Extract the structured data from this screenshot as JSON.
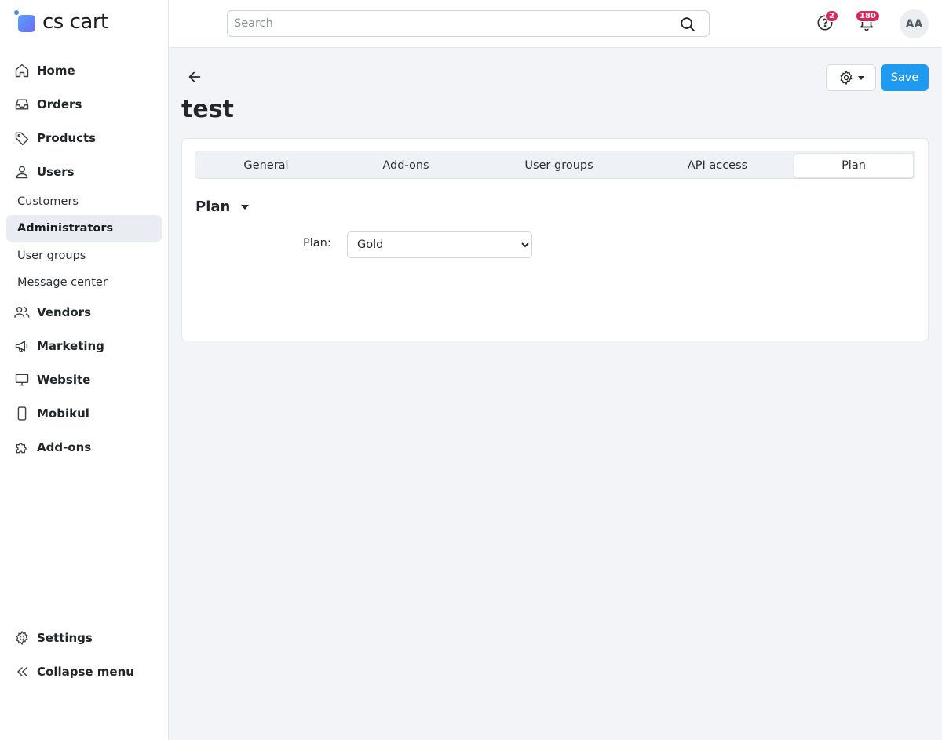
{
  "app": {
    "logo_text": "cs cart"
  },
  "sidebar": {
    "items": [
      {
        "label": "Home",
        "icon": "home-icon"
      },
      {
        "label": "Orders",
        "icon": "inbox-icon"
      },
      {
        "label": "Products",
        "icon": "tag-icon"
      },
      {
        "label": "Users",
        "icon": "user-icon"
      },
      {
        "label": "Vendors",
        "icon": "users-icon"
      },
      {
        "label": "Marketing",
        "icon": "megaphone-icon"
      },
      {
        "label": "Website",
        "icon": "monitor-icon"
      },
      {
        "label": "Mobikul",
        "icon": "phone-icon"
      },
      {
        "label": "Add-ons",
        "icon": "puzzle-icon"
      },
      {
        "label": "Settings",
        "icon": "gear-icon"
      },
      {
        "label": "Collapse menu",
        "icon": "chevrons-left-icon"
      }
    ],
    "users_sub": [
      {
        "label": "Customers",
        "active": false
      },
      {
        "label": "Administrators",
        "active": true
      },
      {
        "label": "User groups",
        "active": false
      },
      {
        "label": "Message center",
        "active": false
      }
    ]
  },
  "topbar": {
    "search_placeholder": "Search",
    "help_badge": "2",
    "notifications_badge": "180",
    "avatar_initials": "AA"
  },
  "page": {
    "title": "test",
    "save_label": "Save",
    "tabs": [
      {
        "label": "General",
        "active": false
      },
      {
        "label": "Add-ons",
        "active": false
      },
      {
        "label": "User groups",
        "active": false
      },
      {
        "label": "API access",
        "active": false
      },
      {
        "label": "Plan",
        "active": true
      }
    ],
    "section_title": "Plan",
    "plan_field": {
      "label": "Plan:",
      "value": "Gold"
    }
  },
  "colors": {
    "primary": "#1e9bf0",
    "badge": "#d9265b",
    "active_bg": "#e9edf3"
  }
}
